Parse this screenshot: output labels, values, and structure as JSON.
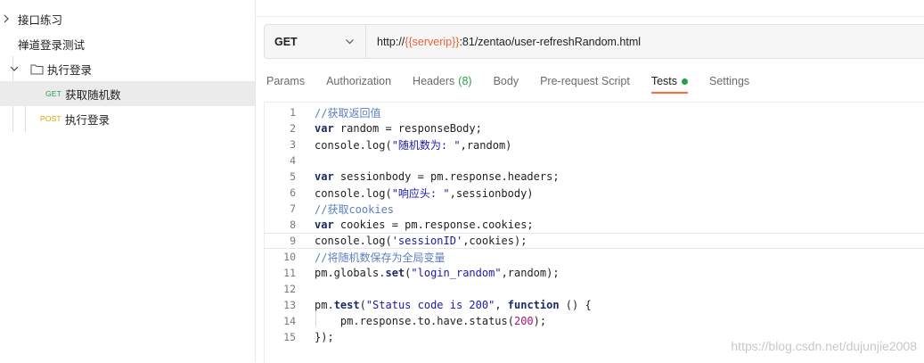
{
  "sidebar": {
    "items": [
      {
        "label": "接口练习"
      },
      {
        "label": "禅道登录测试"
      },
      {
        "label": "执行登录"
      },
      {
        "method": "GET",
        "label": "获取随机数"
      },
      {
        "method": "POST",
        "label": "执行登录"
      }
    ]
  },
  "request": {
    "method": "GET",
    "url_prefix": "http://",
    "url_variable": "{{serverip}}",
    "url_suffix": ":81/zentao/user-refreshRandom.html"
  },
  "tabs": [
    {
      "label": "Params"
    },
    {
      "label": "Authorization"
    },
    {
      "label": "Headers",
      "count": "(8)"
    },
    {
      "label": "Body"
    },
    {
      "label": "Pre-request Script"
    },
    {
      "label": "Tests"
    },
    {
      "label": "Settings"
    }
  ],
  "editor": {
    "line_numbers": [
      "1",
      "2",
      "3",
      "4",
      "5",
      "6",
      "7",
      "8",
      "9",
      "10",
      "11",
      "12",
      "13",
      "14",
      "15"
    ],
    "lines": [
      "//获取返回值",
      "var random = responseBody;",
      "console.log(\"随机数为: \",random)",
      "",
      "var sessionbody = pm.response.headers;",
      "console.log(\"响应头: \",sessionbody)",
      "//获取cookies",
      "var cookies = pm.response.cookies;",
      "console.log('sessionID',cookies);",
      "//将随机数保存为全局变量",
      "pm.globals.set(\"login_random\",random);",
      "",
      "pm.test(\"Status code is 200\", function () {",
      "    pm.response.to.have.status(200);",
      "});"
    ]
  },
  "watermark": "https://blog.csdn.net/dujunjie2008",
  "colors": {
    "accent": "#ff6c37",
    "get": "#2a9d4a",
    "post": "#e0a000",
    "variable": "#e8643c"
  }
}
